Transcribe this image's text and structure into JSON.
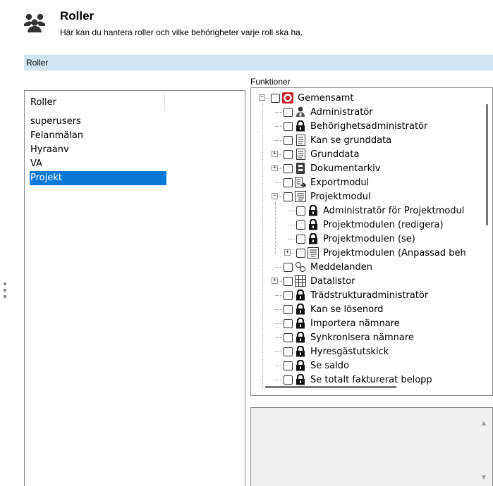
{
  "header": {
    "icon": "users-group-icon",
    "title": "Roller",
    "description": "Här kan du hantera roller och vilke behörigheter varje roll ska ha."
  },
  "section": {
    "label": "Roller"
  },
  "roles": {
    "header": "Roller",
    "items": [
      {
        "label": "superusers",
        "selected": false
      },
      {
        "label": "Felanmälan",
        "selected": false
      },
      {
        "label": "Hyraanv",
        "selected": false
      },
      {
        "label": "VA",
        "selected": false
      },
      {
        "label": "Projekt",
        "selected": true
      }
    ],
    "selected_color": "#0a78d7"
  },
  "functions": {
    "label": "Funktioner",
    "tree": [
      {
        "label": "Gemensamt",
        "icon": "red-ring-icon",
        "expander": "minus"
      },
      {
        "label": "Administratör",
        "icon": "admin-person-icon"
      },
      {
        "label": "Behörighetsadministratör",
        "icon": "lock-icon"
      },
      {
        "label": "Kan se grunddata",
        "icon": "document-icon"
      },
      {
        "label": "Grunddata",
        "icon": "document-icon",
        "expander": "plus"
      },
      {
        "label": "Dokumentarkiv",
        "icon": "archive-icon",
        "expander": "plus"
      },
      {
        "label": "Exportmodul",
        "icon": "export-icon"
      },
      {
        "label": "Projektmodul",
        "icon": "list-icon",
        "expander": "minus"
      },
      {
        "label": "Administratör för Projektmodul",
        "icon": "lock-icon"
      },
      {
        "label": "Projektmodulen (redigera)",
        "icon": "lock-icon"
      },
      {
        "label": "Projektmodulen (se)",
        "icon": "lock-icon"
      },
      {
        "label": "Projektmodulen (Anpassad beh",
        "icon": "list-icon",
        "expander": "plus"
      },
      {
        "label": "Meddelanden",
        "icon": "message-icon"
      },
      {
        "label": "Datalistor",
        "icon": "grid-icon",
        "expander": "plus"
      },
      {
        "label": "Trädstrukturadministratör",
        "icon": "lock-icon"
      },
      {
        "label": "Kan se lösenord",
        "icon": "lock-icon"
      },
      {
        "label": "Importera nämnare",
        "icon": "lock-icon"
      },
      {
        "label": "Synkronisera nämnare",
        "icon": "lock-icon"
      },
      {
        "label": "Hyresgästutskick",
        "icon": "lock-icon"
      },
      {
        "label": "Se saldo",
        "icon": "lock-icon"
      },
      {
        "label": "Se totalt fakturerat belopp",
        "icon": "lock-icon"
      }
    ]
  }
}
